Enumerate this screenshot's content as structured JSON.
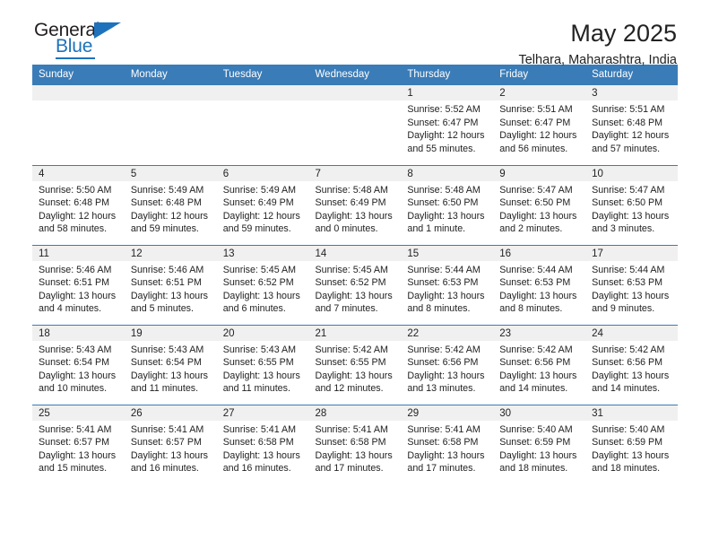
{
  "logo": {
    "word_top": "General",
    "word_bottom": "Blue",
    "triangle": "blue-triangle-icon"
  },
  "header": {
    "month_title": "May 2025",
    "location": "Telhara, Maharashtra, India"
  },
  "colors": {
    "header_blue": "#3a7cb8",
    "logo_blue": "#1e72bb",
    "daynum_strip": "#f0f0f0",
    "text": "#222222"
  },
  "calendar": {
    "weekday_headers": [
      "Sunday",
      "Monday",
      "Tuesday",
      "Wednesday",
      "Thursday",
      "Friday",
      "Saturday"
    ],
    "weeks": [
      [
        {
          "day": "",
          "lines": []
        },
        {
          "day": "",
          "lines": []
        },
        {
          "day": "",
          "lines": []
        },
        {
          "day": "",
          "lines": []
        },
        {
          "day": "1",
          "lines": [
            "Sunrise: 5:52 AM",
            "Sunset: 6:47 PM",
            "Daylight: 12 hours",
            "and 55 minutes."
          ]
        },
        {
          "day": "2",
          "lines": [
            "Sunrise: 5:51 AM",
            "Sunset: 6:47 PM",
            "Daylight: 12 hours",
            "and 56 minutes."
          ]
        },
        {
          "day": "3",
          "lines": [
            "Sunrise: 5:51 AM",
            "Sunset: 6:48 PM",
            "Daylight: 12 hours",
            "and 57 minutes."
          ]
        }
      ],
      [
        {
          "day": "4",
          "lines": [
            "Sunrise: 5:50 AM",
            "Sunset: 6:48 PM",
            "Daylight: 12 hours",
            "and 58 minutes."
          ]
        },
        {
          "day": "5",
          "lines": [
            "Sunrise: 5:49 AM",
            "Sunset: 6:48 PM",
            "Daylight: 12 hours",
            "and 59 minutes."
          ]
        },
        {
          "day": "6",
          "lines": [
            "Sunrise: 5:49 AM",
            "Sunset: 6:49 PM",
            "Daylight: 12 hours",
            "and 59 minutes."
          ]
        },
        {
          "day": "7",
          "lines": [
            "Sunrise: 5:48 AM",
            "Sunset: 6:49 PM",
            "Daylight: 13 hours",
            "and 0 minutes."
          ]
        },
        {
          "day": "8",
          "lines": [
            "Sunrise: 5:48 AM",
            "Sunset: 6:50 PM",
            "Daylight: 13 hours",
            "and 1 minute."
          ]
        },
        {
          "day": "9",
          "lines": [
            "Sunrise: 5:47 AM",
            "Sunset: 6:50 PM",
            "Daylight: 13 hours",
            "and 2 minutes."
          ]
        },
        {
          "day": "10",
          "lines": [
            "Sunrise: 5:47 AM",
            "Sunset: 6:50 PM",
            "Daylight: 13 hours",
            "and 3 minutes."
          ]
        }
      ],
      [
        {
          "day": "11",
          "lines": [
            "Sunrise: 5:46 AM",
            "Sunset: 6:51 PM",
            "Daylight: 13 hours",
            "and 4 minutes."
          ]
        },
        {
          "day": "12",
          "lines": [
            "Sunrise: 5:46 AM",
            "Sunset: 6:51 PM",
            "Daylight: 13 hours",
            "and 5 minutes."
          ]
        },
        {
          "day": "13",
          "lines": [
            "Sunrise: 5:45 AM",
            "Sunset: 6:52 PM",
            "Daylight: 13 hours",
            "and 6 minutes."
          ]
        },
        {
          "day": "14",
          "lines": [
            "Sunrise: 5:45 AM",
            "Sunset: 6:52 PM",
            "Daylight: 13 hours",
            "and 7 minutes."
          ]
        },
        {
          "day": "15",
          "lines": [
            "Sunrise: 5:44 AM",
            "Sunset: 6:53 PM",
            "Daylight: 13 hours",
            "and 8 minutes."
          ]
        },
        {
          "day": "16",
          "lines": [
            "Sunrise: 5:44 AM",
            "Sunset: 6:53 PM",
            "Daylight: 13 hours",
            "and 8 minutes."
          ]
        },
        {
          "day": "17",
          "lines": [
            "Sunrise: 5:44 AM",
            "Sunset: 6:53 PM",
            "Daylight: 13 hours",
            "and 9 minutes."
          ]
        }
      ],
      [
        {
          "day": "18",
          "lines": [
            "Sunrise: 5:43 AM",
            "Sunset: 6:54 PM",
            "Daylight: 13 hours",
            "and 10 minutes."
          ]
        },
        {
          "day": "19",
          "lines": [
            "Sunrise: 5:43 AM",
            "Sunset: 6:54 PM",
            "Daylight: 13 hours",
            "and 11 minutes."
          ]
        },
        {
          "day": "20",
          "lines": [
            "Sunrise: 5:43 AM",
            "Sunset: 6:55 PM",
            "Daylight: 13 hours",
            "and 11 minutes."
          ]
        },
        {
          "day": "21",
          "lines": [
            "Sunrise: 5:42 AM",
            "Sunset: 6:55 PM",
            "Daylight: 13 hours",
            "and 12 minutes."
          ]
        },
        {
          "day": "22",
          "lines": [
            "Sunrise: 5:42 AM",
            "Sunset: 6:56 PM",
            "Daylight: 13 hours",
            "and 13 minutes."
          ]
        },
        {
          "day": "23",
          "lines": [
            "Sunrise: 5:42 AM",
            "Sunset: 6:56 PM",
            "Daylight: 13 hours",
            "and 14 minutes."
          ]
        },
        {
          "day": "24",
          "lines": [
            "Sunrise: 5:42 AM",
            "Sunset: 6:56 PM",
            "Daylight: 13 hours",
            "and 14 minutes."
          ]
        }
      ],
      [
        {
          "day": "25",
          "lines": [
            "Sunrise: 5:41 AM",
            "Sunset: 6:57 PM",
            "Daylight: 13 hours",
            "and 15 minutes."
          ]
        },
        {
          "day": "26",
          "lines": [
            "Sunrise: 5:41 AM",
            "Sunset: 6:57 PM",
            "Daylight: 13 hours",
            "and 16 minutes."
          ]
        },
        {
          "day": "27",
          "lines": [
            "Sunrise: 5:41 AM",
            "Sunset: 6:58 PM",
            "Daylight: 13 hours",
            "and 16 minutes."
          ]
        },
        {
          "day": "28",
          "lines": [
            "Sunrise: 5:41 AM",
            "Sunset: 6:58 PM",
            "Daylight: 13 hours",
            "and 17 minutes."
          ]
        },
        {
          "day": "29",
          "lines": [
            "Sunrise: 5:41 AM",
            "Sunset: 6:58 PM",
            "Daylight: 13 hours",
            "and 17 minutes."
          ]
        },
        {
          "day": "30",
          "lines": [
            "Sunrise: 5:40 AM",
            "Sunset: 6:59 PM",
            "Daylight: 13 hours",
            "and 18 minutes."
          ]
        },
        {
          "day": "31",
          "lines": [
            "Sunrise: 5:40 AM",
            "Sunset: 6:59 PM",
            "Daylight: 13 hours",
            "and 18 minutes."
          ]
        }
      ]
    ]
  }
}
